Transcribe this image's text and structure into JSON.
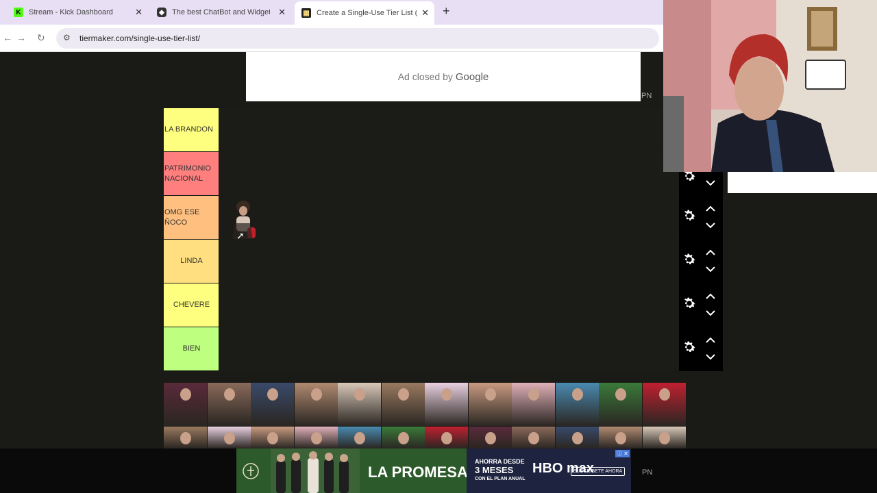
{
  "browser": {
    "tabs": [
      {
        "title": "Stream - Kick Dashboard",
        "icon": "kick-icon"
      },
      {
        "title": "The best ChatBot and Widgets f",
        "icon": "chatbot-icon"
      },
      {
        "title": "Create a Single-Use Tier List (Pr",
        "icon": "tiermaker-icon"
      }
    ],
    "url": "tiermaker.com/single-use-tier-list/"
  },
  "ads": {
    "top_text": "Ad closed by",
    "top_brand": "Google",
    "pn_label": "PN",
    "bottom_title": "LA PROMESA",
    "bottom_offer_line1": "AHORRA DESDE",
    "bottom_offer_line2": "3 MESES",
    "bottom_offer_line3": "CON EL PLAN ANUAL",
    "bottom_brand": "HBO max",
    "bottom_cta": "SUSCRÍBETE AHORA"
  },
  "tiers": [
    {
      "label": "LA BRANDON",
      "color": "#ffff7f"
    },
    {
      "label": "PATRIMONIO NACIONAL",
      "color": "#ff7f7f"
    },
    {
      "label": "OMG ESE ÑOCO",
      "color": "#ffbf7f"
    },
    {
      "label": "LINDA",
      "color": "#ffdf7f"
    },
    {
      "label": "CHEVERE",
      "color": "#ffff7f"
    },
    {
      "label": "BIEN",
      "color": "#bfff7f"
    }
  ],
  "colors": {
    "page_bg": "#1a1a17",
    "control_bg": "#000000",
    "accent_tab": "#e8dff5"
  }
}
